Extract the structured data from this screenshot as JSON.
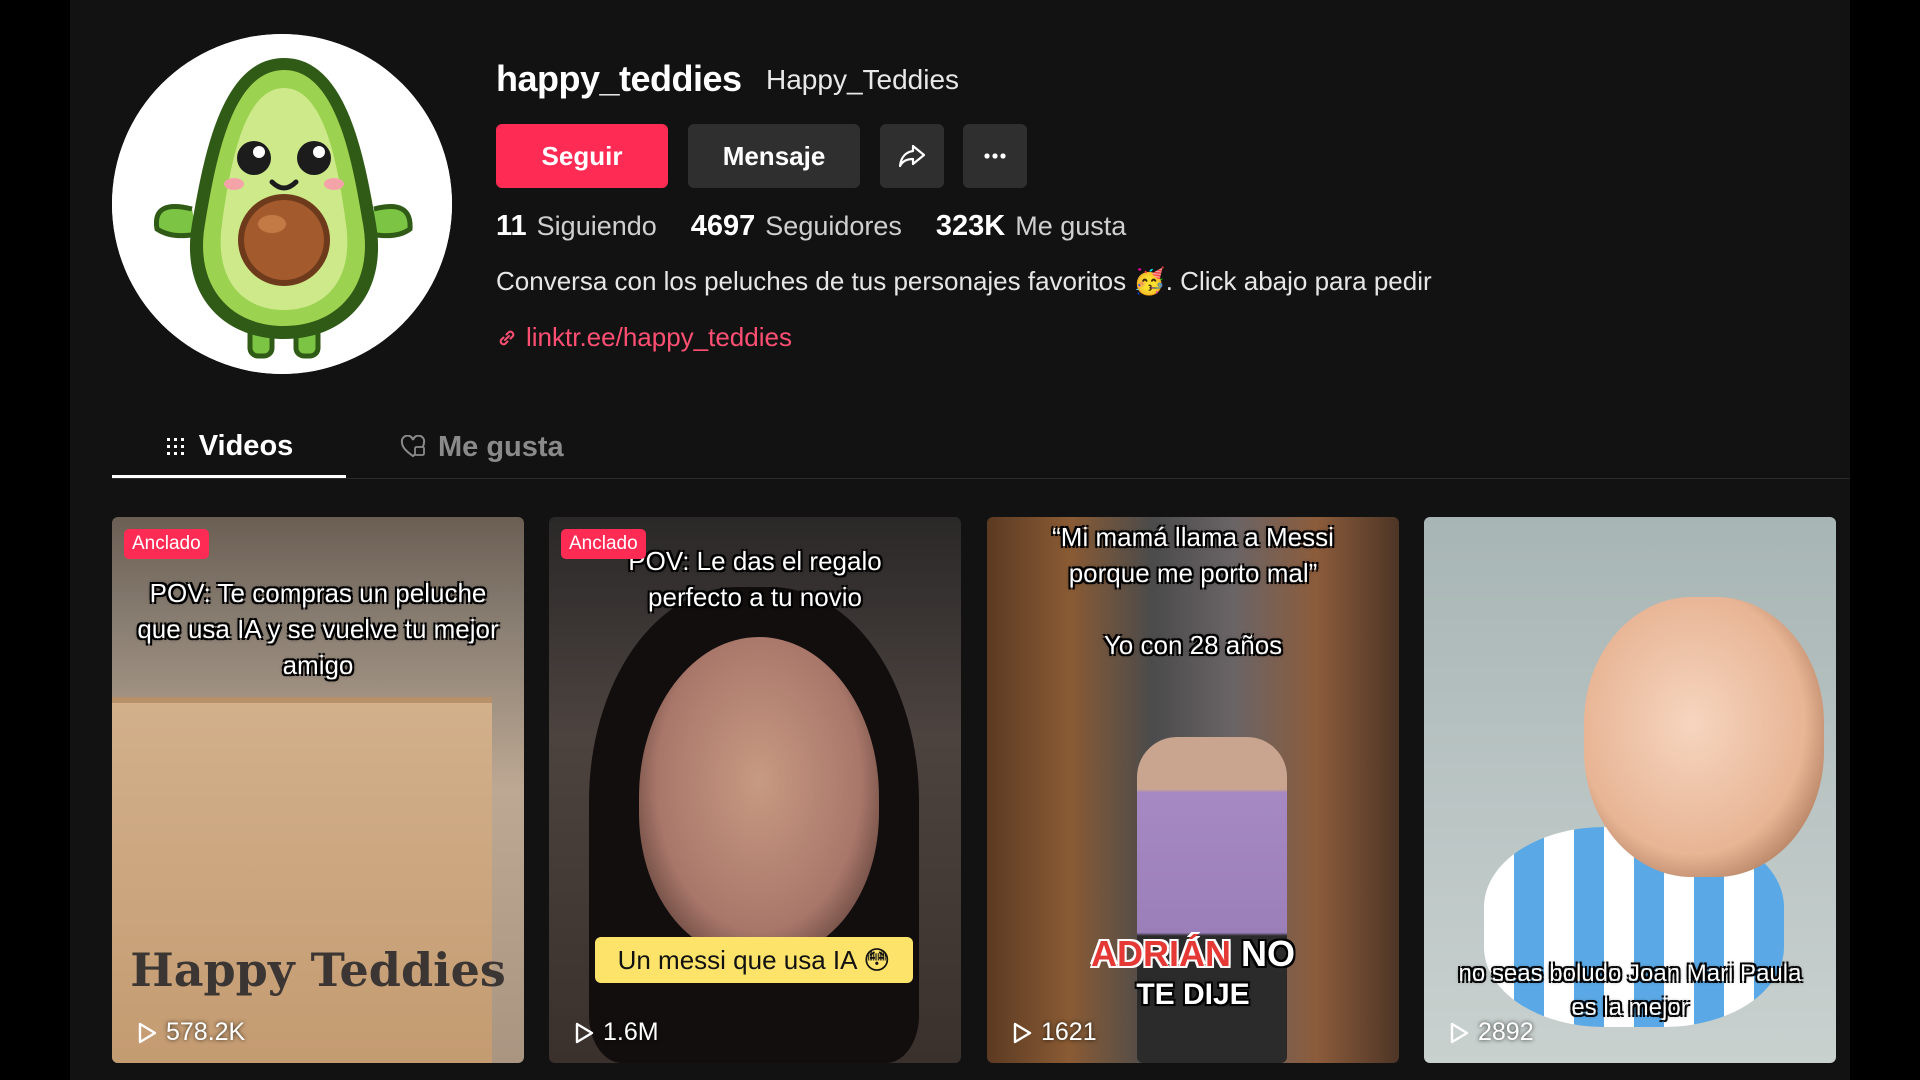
{
  "profile": {
    "handle": "happy_teddies",
    "nickname": "Happy_Teddies",
    "follow_label": "Seguir",
    "message_label": "Mensaje",
    "stats": [
      {
        "value": "11",
        "label": "Siguiendo"
      },
      {
        "value": "4697",
        "label": "Seguidores"
      },
      {
        "value": "323K",
        "label": "Me gusta"
      }
    ],
    "bio": "Conversa con los peluches de tus personajes favoritos 🥳. Click abajo para pedir",
    "link": "linktr.ee/happy_teddies"
  },
  "tabs": {
    "videos": "Videos",
    "likes": "Me gusta"
  },
  "videos": [
    {
      "badge": "Anclado",
      "caption": "POV: Te compras un peluche que usa IA y se vuelve tu mejor amigo",
      "overlay": "Happy Teddies",
      "views": "578.2K"
    },
    {
      "badge": "Anclado",
      "caption": "POV: Le das el regalo perfecto a tu novio",
      "overlay": "Un messi que usa IA 😳",
      "views": "1.6M"
    },
    {
      "caption": "“Mi mamá llama a Messi porque me porto mal”",
      "subcaption": "Yo con 28 años",
      "overlay_red": "ADRIÁN",
      "overlay_white": "NO",
      "overlay_line2": "TE DIJE",
      "views": "1621"
    },
    {
      "caption": "no seas boludo Joan Mari Paula es la mejor",
      "views": "2892"
    }
  ],
  "colors": {
    "accent": "#fe2c55",
    "link": "#fe4f73",
    "background": "#121212"
  }
}
